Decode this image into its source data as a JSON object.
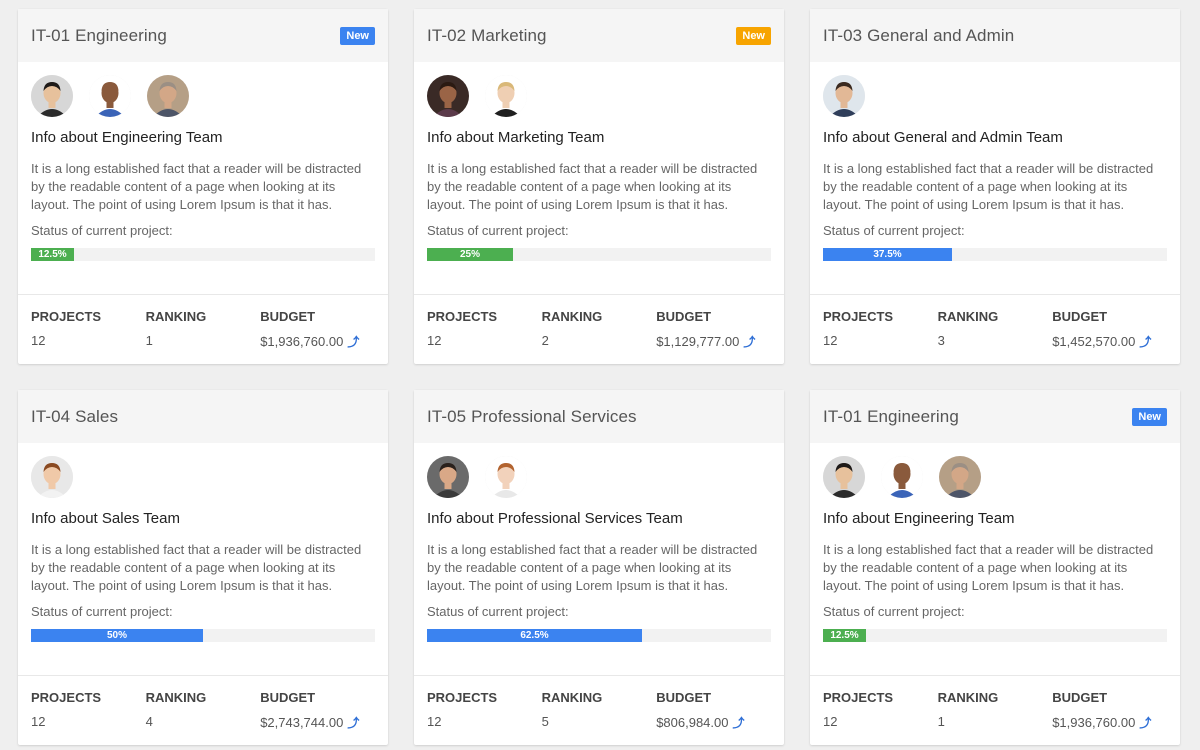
{
  "cards": [
    {
      "title": "IT-01 Engineering",
      "badge": {
        "label": "New",
        "color": "#3b83f0"
      },
      "avatars": [
        {
          "name": "avatar-asian-man-icon",
          "skin": "#e7c19c",
          "hair": "#1e1a18",
          "shirt": "#2b2b2b",
          "bg": "#d7d7d7"
        },
        {
          "name": "avatar-bald-man-icon",
          "skin": "#8a5a3c",
          "hair": "#8a5a3c",
          "shirt": "#3b64b8",
          "bg": "#ffffff"
        },
        {
          "name": "avatar-gray-hair-man-icon",
          "skin": "#d3a787",
          "hair": "#9b8f84",
          "shirt": "#4d5568",
          "bg": "#b59f86"
        }
      ],
      "team_info": "Info about Engineering Team",
      "description": "It is a long established fact that a reader will be distracted by the readable content of a page when looking at its layout. The point of using Lorem Ipsum is that it has.",
      "status_label": "Status of current project:",
      "progress": {
        "value": 12.5,
        "label": "12.5%",
        "color": "#4caf50"
      },
      "stats": {
        "projects_label": "PROJECTS",
        "projects": "12",
        "ranking_label": "RANKING",
        "ranking": "1",
        "budget_label": "BUDGET",
        "budget": "$1,936,760.00"
      }
    },
    {
      "title": "IT-02 Marketing",
      "badge": {
        "label": "New",
        "color": "#f7a400"
      },
      "avatars": [
        {
          "name": "avatar-woman-dark-hair-icon",
          "skin": "#9a6446",
          "hair": "#2b1a12",
          "shirt": "#5b3a4a",
          "bg": "#3a2a26"
        },
        {
          "name": "avatar-blonde-woman-icon",
          "skin": "#efcfb3",
          "hair": "#d9b878",
          "shirt": "#1f1f1f",
          "bg": "#ffffff"
        }
      ],
      "team_info": "Info about Marketing Team",
      "description": "It is a long established fact that a reader will be distracted by the readable content of a page when looking at its layout. The point of using Lorem Ipsum is that it has.",
      "status_label": "Status of current project:",
      "progress": {
        "value": 25,
        "label": "25%",
        "color": "#4caf50"
      },
      "stats": {
        "projects_label": "PROJECTS",
        "projects": "12",
        "ranking_label": "RANKING",
        "ranking": "2",
        "budget_label": "BUDGET",
        "budget": "$1,129,777.00"
      }
    },
    {
      "title": "IT-03 General and Admin",
      "badge": null,
      "avatars": [
        {
          "name": "avatar-man-suit-icon",
          "skin": "#e2b896",
          "hair": "#3a2a20",
          "shirt": "#2f3e5a",
          "bg": "#dfe6ec"
        }
      ],
      "team_info": "Info about General and Admin Team",
      "description": "It is a long established fact that a reader will be distracted by the readable content of a page when looking at its layout. The point of using Lorem Ipsum is that it has.",
      "status_label": "Status of current project:",
      "progress": {
        "value": 37.5,
        "label": "37.5%",
        "color": "#3b83f0"
      },
      "stats": {
        "projects_label": "PROJECTS",
        "projects": "12",
        "ranking_label": "RANKING",
        "ranking": "3",
        "budget_label": "BUDGET",
        "budget": "$1,452,570.00"
      }
    },
    {
      "title": "IT-04 Sales",
      "badge": null,
      "avatars": [
        {
          "name": "avatar-woman-brown-hair-icon",
          "skin": "#f0c9a8",
          "hair": "#8a4a22",
          "shirt": "#f2f2f2",
          "bg": "#e8e8e8"
        }
      ],
      "team_info": "Info about Sales Team",
      "description": "It is a long established fact that a reader will be distracted by the readable content of a page when looking at its layout. The point of using Lorem Ipsum is that it has.",
      "status_label": "Status of current project:",
      "progress": {
        "value": 50,
        "label": "50%",
        "color": "#3b83f0"
      },
      "stats": {
        "projects_label": "PROJECTS",
        "projects": "12",
        "ranking_label": "RANKING",
        "ranking": "4",
        "budget_label": "BUDGET",
        "budget": "$2,743,744.00"
      }
    },
    {
      "title": "IT-05 Professional Services",
      "badge": null,
      "avatars": [
        {
          "name": "avatar-man-dark-hair-icon",
          "skin": "#d9a887",
          "hair": "#2a211c",
          "shirt": "#3a3a3a",
          "bg": "#6a6a6a"
        },
        {
          "name": "avatar-woman-red-hair-icon",
          "skin": "#f2d2bb",
          "hair": "#b2632f",
          "shirt": "#e8e8e8",
          "bg": "#ffffff"
        }
      ],
      "team_info": "Info about Professional Services Team",
      "description": "It is a long established fact that a reader will be distracted by the readable content of a page when looking at its layout. The point of using Lorem Ipsum is that it has.",
      "status_label": "Status of current project:",
      "progress": {
        "value": 62.5,
        "label": "62.5%",
        "color": "#3b83f0"
      },
      "stats": {
        "projects_label": "PROJECTS",
        "projects": "12",
        "ranking_label": "RANKING",
        "ranking": "5",
        "budget_label": "BUDGET",
        "budget": "$806,984.00"
      }
    },
    {
      "title": "IT-01 Engineering",
      "badge": {
        "label": "New",
        "color": "#3b83f0"
      },
      "avatars": [
        {
          "name": "avatar-asian-man-icon",
          "skin": "#e7c19c",
          "hair": "#1e1a18",
          "shirt": "#2b2b2b",
          "bg": "#d7d7d7"
        },
        {
          "name": "avatar-bald-man-icon",
          "skin": "#8a5a3c",
          "hair": "#8a5a3c",
          "shirt": "#3b64b8",
          "bg": "#ffffff"
        },
        {
          "name": "avatar-gray-hair-man-icon",
          "skin": "#d3a787",
          "hair": "#9b8f84",
          "shirt": "#4d5568",
          "bg": "#b59f86"
        }
      ],
      "team_info": "Info about Engineering Team",
      "description": "It is a long established fact that a reader will be distracted by the readable content of a page when looking at its layout. The point of using Lorem Ipsum is that it has.",
      "status_label": "Status of current project:",
      "progress": {
        "value": 12.5,
        "label": "12.5%",
        "color": "#4caf50"
      },
      "stats": {
        "projects_label": "PROJECTS",
        "projects": "12",
        "ranking_label": "RANKING",
        "ranking": "1",
        "budget_label": "BUDGET",
        "budget": "$1,936,760.00"
      }
    }
  ],
  "trend_icon": "arrow-up-icon"
}
